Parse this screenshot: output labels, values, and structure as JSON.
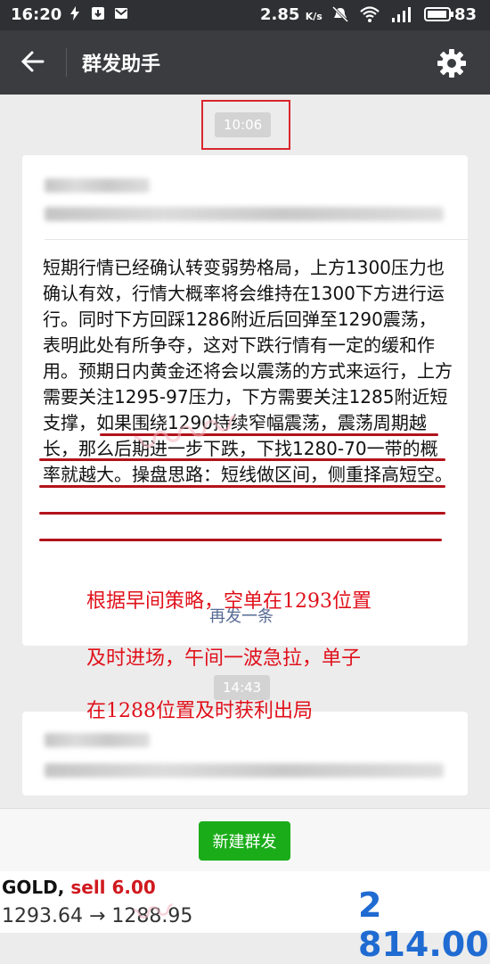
{
  "status_bar": {
    "time": "16:20",
    "net_speed": "2.85",
    "net_unit": "K/s",
    "battery": "83"
  },
  "header": {
    "title": "群发助手"
  },
  "messages": [
    {
      "time": "10:06",
      "body": "短期行情已经确认转变弱势格局，上方1300压力也确认有效，行情大概率将会维持在1300下方进行运行。同时下方回踩1286附近后回弹至1290震荡，表明此处有所争夺，这对下跌行情有一定的缓和作用。预期日内黄金还将会以震荡的方式来运行，上方需要关注1295-97压力，下方需要关注1285附近短支撑，如果围绕1290持续窄幅震荡，震荡周期越长，那么后期进一步下跌，下找1280-70一带的概率就越大。操盘思路：短线做区间，侧重择高短空。",
      "resend_label": "再发一条"
    },
    {
      "time": "14:43"
    }
  ],
  "annotation": {
    "lines": [
      "根据早间策略，空单在1293位置",
      "及时进场，午间一波急拉，单子",
      "在1288位置及时获利出局"
    ]
  },
  "footer": {
    "new_broadcast_label": "新建群发"
  },
  "ticker": {
    "symbol": "GOLD,",
    "action": "sell 6.00",
    "price_move": "1293.64 → 1288.95",
    "total": "2 814.00"
  },
  "colors": {
    "accent_green": "#1aad19",
    "annotation_red": "#e0111b",
    "link_blue": "#576b95",
    "total_blue": "#1f6bd2"
  }
}
